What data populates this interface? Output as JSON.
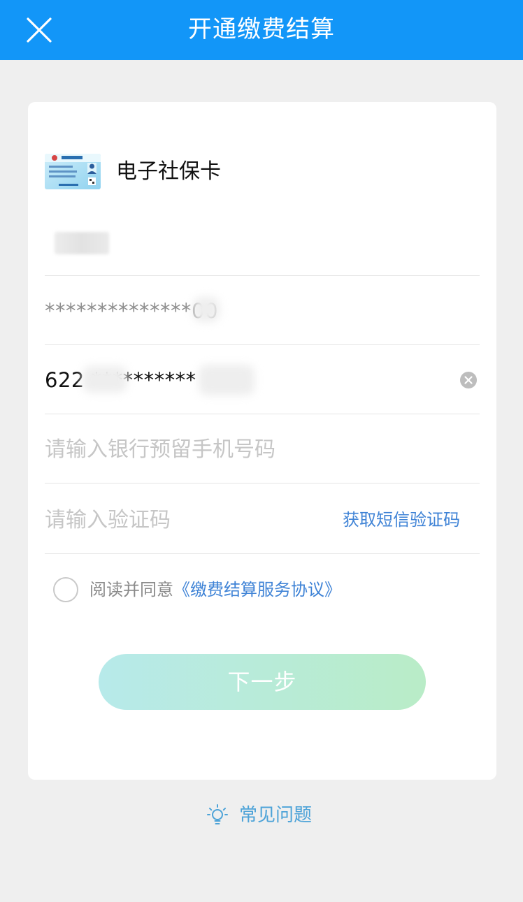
{
  "header": {
    "title": "开通缴费结算"
  },
  "card": {
    "title": "电子社保卡",
    "id_number_masked": "**************00",
    "bank_card_masked": "622          **********",
    "phone_placeholder": "请输入银行预留手机号码",
    "code_placeholder": "请输入验证码",
    "sms_button": "获取短信验证码",
    "agree_prefix": "阅读并同意",
    "agree_link": "《缴费结算服务协议》",
    "next_button": "下一步"
  },
  "footer": {
    "faq": "常见问题"
  },
  "colors": {
    "header_bg": "#1296f8",
    "link": "#3f83d6",
    "faq": "#4da3d8",
    "button_gradient_start": "#b7eaea",
    "button_gradient_end": "#b9ecc7"
  },
  "icons": {
    "close": "close-icon",
    "clear": "clear-circle-icon",
    "faq": "lightbulb-icon",
    "card": "social-security-card-icon"
  }
}
